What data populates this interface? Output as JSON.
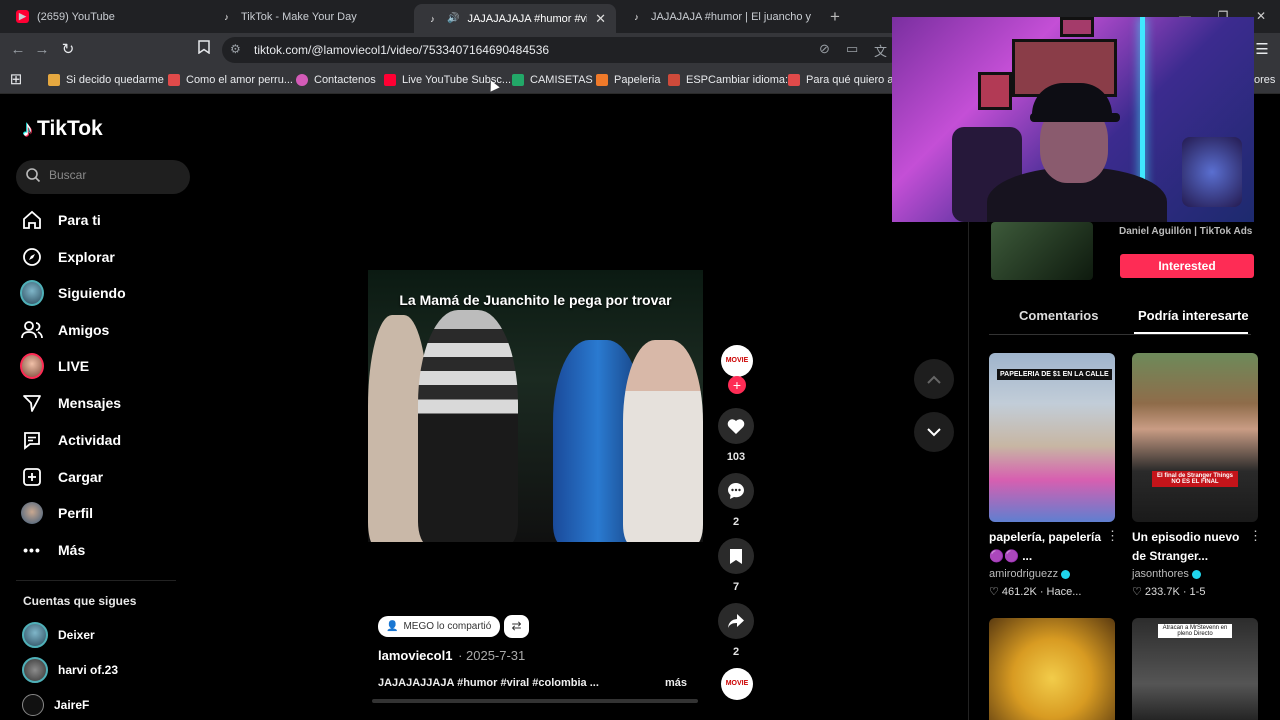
{
  "browser": {
    "tabs": [
      {
        "title": "(2659) YouTube",
        "icon": "youtube-icon",
        "active": false
      },
      {
        "title": "TikTok - Make Your Day",
        "icon": "tiktok-icon",
        "active": false
      },
      {
        "title": "JAJAJAJAJA #humor #viral #c",
        "icon": "tiktok-icon",
        "active": true
      },
      {
        "title": "JAJAJAJA #humor | El juancho y su h",
        "icon": "tiktok-icon",
        "active": false
      }
    ],
    "url": "tiktok.com/@lamoviecol1/video/7533407164690484536",
    "bookmarks": [
      {
        "label": "Si decido quedarme",
        "color": "#e5a840"
      },
      {
        "label": "Como el amor perru...",
        "color": "#e04a4a"
      },
      {
        "label": "Contactenos",
        "color": "#d45bb8"
      },
      {
        "label": "Live YouTube Subsc...",
        "color": "#ff0033"
      },
      {
        "label": "CAMISETAS",
        "color": "#22a868"
      },
      {
        "label": "Papeleria",
        "color": "#f07a2a"
      },
      {
        "label": "ESPCambiar idioma:",
        "color": "#cf4a3a"
      },
      {
        "label": "Para qué quiero asp",
        "color": "#e04a4a"
      },
      {
        "label": "ores",
        "color": "#777777"
      }
    ]
  },
  "sidebar": {
    "logo": "TikTok",
    "search_placeholder": "Buscar",
    "nav": [
      {
        "label": "Para ti",
        "icon": "home-icon"
      },
      {
        "label": "Explorar",
        "icon": "compass-icon"
      },
      {
        "label": "Siguiendo",
        "icon": "following-avatar-icon"
      },
      {
        "label": "Amigos",
        "icon": "friends-icon"
      },
      {
        "label": "LIVE",
        "icon": "live-avatar-icon"
      },
      {
        "label": "Mensajes",
        "icon": "send-icon"
      },
      {
        "label": "Actividad",
        "icon": "activity-icon"
      },
      {
        "label": "Cargar",
        "icon": "upload-icon"
      },
      {
        "label": "Perfil",
        "icon": "profile-avatar-icon"
      },
      {
        "label": "Más",
        "icon": "more-dots-icon"
      }
    ],
    "following_title": "Cuentas que sigues",
    "following": [
      {
        "name": "Deixer"
      },
      {
        "name": "harvi of.23"
      },
      {
        "name": "JaireF"
      }
    ]
  },
  "video": {
    "caption": "La Mamá de Juanchito le pega por trovar",
    "shared_by": "MEGO lo compartió",
    "author": "lamoviecol1",
    "date": "· 2025-7-31",
    "description": "JAJAJAJJAJA #humor #viral #colombia ...",
    "more_label": "más",
    "progress": 0.0,
    "creator_badge": "MOVIE",
    "likes": "103",
    "comments": "2",
    "saves": "7",
    "shares": "2"
  },
  "right_panel": {
    "ad_name": "Daniel Aguillón | TikTok Ads",
    "interested_label": "Interested",
    "tabs": [
      {
        "label": "Comentarios",
        "active": false
      },
      {
        "label": "Podría interesarte",
        "active": true
      }
    ],
    "cards": [
      {
        "title": "papelería, papelería 🟣🟣 ...",
        "author": "amirodriguezz",
        "stats": "♡ 461.2K · Hace...",
        "thumb_text": "PAPELERIA DE $1 EN LA CALLE"
      },
      {
        "title": "Un episodio nuevo de Stranger...",
        "author": "jasonthores",
        "stats": "♡ 233.7K · 1-5",
        "thumb_text": "El final de Stranger Things NO ES EL FINAL"
      },
      {
        "title": "",
        "author": "",
        "stats": "",
        "thumb_text": ""
      },
      {
        "title": "",
        "author": "",
        "stats": "",
        "thumb_text": "Atracan a MrStevenn en pleno Directo"
      }
    ]
  },
  "colors": {
    "accent": "#fe2c55",
    "verified": "#20d5ec",
    "panel": "#000000"
  }
}
